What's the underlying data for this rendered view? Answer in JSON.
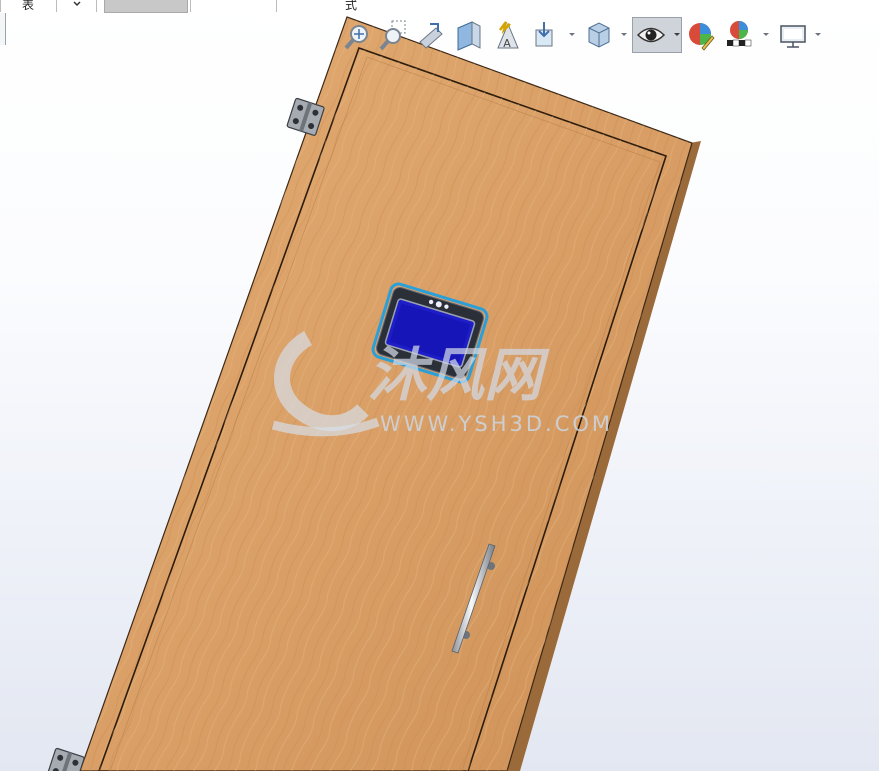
{
  "tabs": [
    {
      "label": "表"
    },
    {
      "label": "式"
    }
  ],
  "toolbar": {
    "buttons": [
      {
        "icon": "zoom-to-fit-icon"
      },
      {
        "icon": "zoom-to-area-icon"
      },
      {
        "icon": "previous-view-icon"
      },
      {
        "icon": "section-view-icon"
      },
      {
        "icon": "dynamic-annotation-icon"
      },
      {
        "icon": "view-orientation-icon"
      },
      {
        "icon": "display-style-icon"
      },
      {
        "icon": "hide-show-items-icon"
      },
      {
        "icon": "edit-appearance-icon"
      },
      {
        "icon": "apply-scene-icon"
      },
      {
        "icon": "view-settings-icon"
      }
    ],
    "active_button": "hide-show-items-icon"
  },
  "model": {
    "part": "wooden-door",
    "wood_color": "#d89d63",
    "edge_color": "#8a5a2c",
    "screen_color": "#1e1ec8",
    "selection_color": "#2a9fd8"
  },
  "watermark": {
    "logo_text": "沐风网",
    "url_text": "WWW.YSH3D.COM"
  }
}
